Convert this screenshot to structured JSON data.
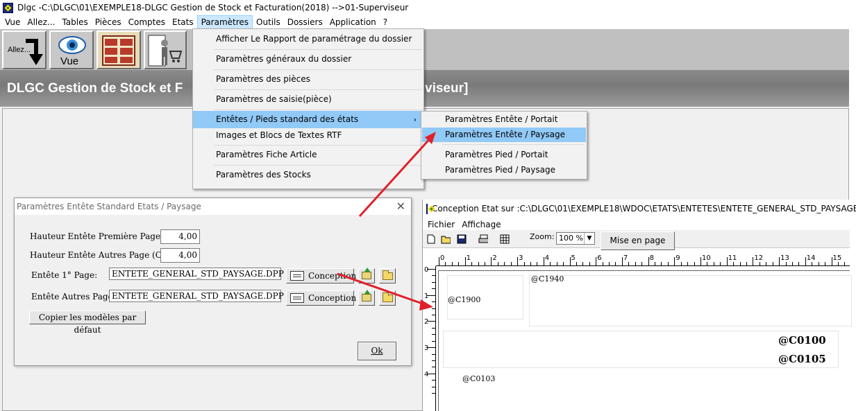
{
  "window": {
    "title": "Dlgc -C:\\DLGC\\01\\EXEMPLE18-DLGC Gestion de Stock et Facturation(2018) -->01-Superviseur"
  },
  "menubar": [
    {
      "label": "Vue"
    },
    {
      "label": "Allez..."
    },
    {
      "label": "Tables"
    },
    {
      "label": "Pièces"
    },
    {
      "label": "Comptes"
    },
    {
      "label": "Etats"
    },
    {
      "label": "Paramètres",
      "active": true
    },
    {
      "label": "Outils"
    },
    {
      "label": "Dossiers"
    },
    {
      "label": "Application"
    },
    {
      "label": "?"
    }
  ],
  "toolbar": {
    "allez_label": "Allez...",
    "vue_label": "Vue"
  },
  "band": {
    "title_left": "DLGC Gestion de Stock et F",
    "title_right": "viseur]"
  },
  "params_menu": {
    "items": [
      {
        "label": "Afficher Le Rapport de paramétrage du dossier"
      },
      {
        "label": "Paramètres généraux du dossier"
      },
      {
        "label": "Paramètres des pièces"
      },
      {
        "label": "Paramètres de saisie(pièce)"
      },
      {
        "label": "Entêtes / Pieds standard des états",
        "has_submenu": true,
        "highlighted": true
      },
      {
        "label": "Images et Blocs de Textes RTF"
      },
      {
        "label": "Paramètres Fiche Article"
      },
      {
        "label": "Paramètres des Stocks"
      }
    ],
    "submenu_arrow": "›"
  },
  "sub_menu": {
    "items": [
      {
        "label": "Paramètres Entête / Portait"
      },
      {
        "label": "Paramètres Entête / Paysage",
        "highlighted": true
      },
      {
        "label": "Paramètres Pied / Portait"
      },
      {
        "label": "Paramètres Pied / Paysage"
      }
    ]
  },
  "dialog": {
    "title": "Paramètres Entête Standard Etats / Paysage",
    "close_glyph": "✕",
    "hauteur_premiere_label": "Hauteur Entête Première Page (Cm):",
    "hauteur_premiere_value": "4,00",
    "hauteur_autres_label": "Hauteur Entête Autres Page (Cm):",
    "hauteur_autres_value": "4,00",
    "entete_1_label": "Entête 1° Page:",
    "entete_1_value": "ENTETE_GENERAL_STD_PAYSAGE.DPP",
    "entete_autres_label": "Entête Autres Pages:",
    "entete_autres_value": "ENTETE_GENERAL_STD_PAYSAGE.DPP",
    "conception_label": "Conception",
    "copier_label": "Copier les modèles par défaut",
    "ok_label": "Ok"
  },
  "design_window": {
    "title": "Conception Etat sur :C:\\DLGC\\01\\EXEMPLE18\\WDOC\\ETATS\\ENTETES\\ENTETE_GENERAL_STD_PAYSAGE.DPP",
    "menu": [
      "Fichier",
      "Affichage"
    ],
    "zoom_label": "Zoom:",
    "zoom_value": "100 %",
    "mise_en_page_label": "Mise en page",
    "ruler_h": [
      "0",
      "1",
      "2",
      "3",
      "4",
      "5",
      "6",
      "7",
      "8",
      "9",
      "10",
      "11",
      "12",
      "13",
      "14",
      "15"
    ],
    "ruler_v": [
      "0",
      "1",
      "2",
      "3",
      "4"
    ],
    "fields": {
      "c1940": "@C1940",
      "c1900": "@C1900",
      "c0100": "@C0100",
      "c0105": "@C0105",
      "c0103": "@C0103"
    }
  },
  "colors": {
    "menu_highlight": "#91c9f7",
    "active_menu": "#cce8ff",
    "arrow": "#e0202a"
  }
}
